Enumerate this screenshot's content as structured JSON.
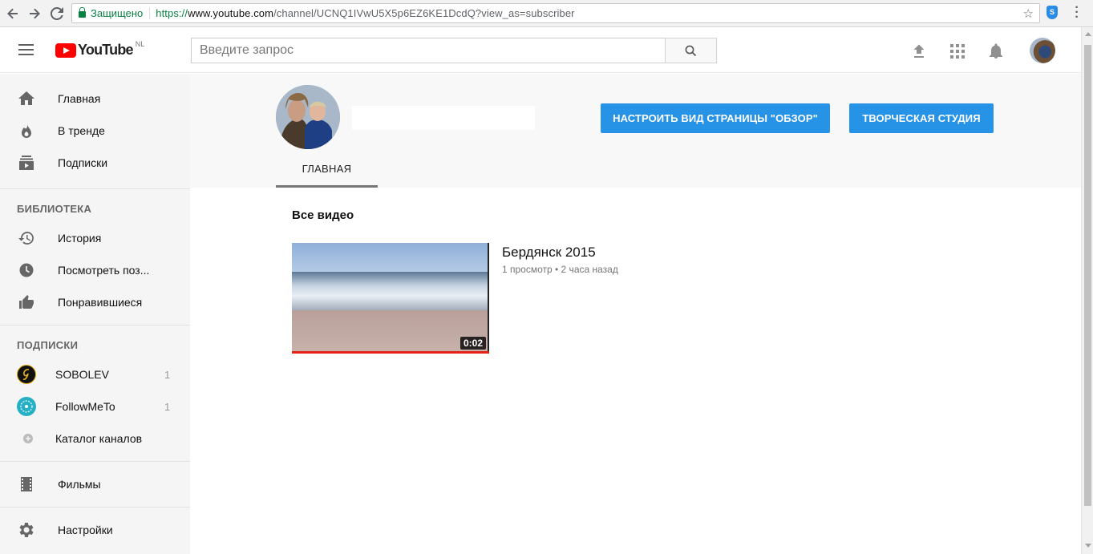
{
  "browser": {
    "secure_label": "Защищено",
    "url_proto": "https://",
    "url_host": "www.youtube.com",
    "url_path": "/channel/UCNQ1IVwU5X5p6EZ6KE1DcdQ?view_as=subscriber",
    "extension_glyph": "S"
  },
  "masthead": {
    "logo_text": "YouTube",
    "region": "NL",
    "search_placeholder": "Введите запрос"
  },
  "sidebar": {
    "main": [
      {
        "label": "Главная",
        "icon": "home-icon"
      },
      {
        "label": "В тренде",
        "icon": "fire-icon"
      },
      {
        "label": "Подписки",
        "icon": "subscriptions-icon"
      }
    ],
    "library_heading": "БИБЛИОТЕКА",
    "library": [
      {
        "label": "История",
        "icon": "history-icon"
      },
      {
        "label": "Посмотреть поз...",
        "icon": "clock-icon"
      },
      {
        "label": "Понравившиеся",
        "icon": "thumbs-up-icon"
      }
    ],
    "subscriptions_heading": "ПОДПИСКИ",
    "subscriptions": [
      {
        "label": "SOBOLEV",
        "count": "1"
      },
      {
        "label": "FollowMeTo",
        "count": "1"
      },
      {
        "label": "Каталог каналов",
        "count": ""
      }
    ],
    "movies": "Фильмы",
    "settings": "Настройки"
  },
  "channel": {
    "customize_button": "НАСТРОИТЬ ВИД СТРАНИЦЫ \"ОБЗОР\"",
    "studio_button": "ТВОРЧЕСКАЯ СТУДИЯ",
    "tab_home": "ГЛАВНАЯ"
  },
  "content": {
    "section_title": "Все видео",
    "video": {
      "title": "Бердянск 2015",
      "meta": "1 просмотр • 2 часа назад",
      "duration": "0:02"
    }
  },
  "colors": {
    "accent_blue": "#2793e6",
    "youtube_red": "#ff0000",
    "secure_green": "#0b8043"
  }
}
